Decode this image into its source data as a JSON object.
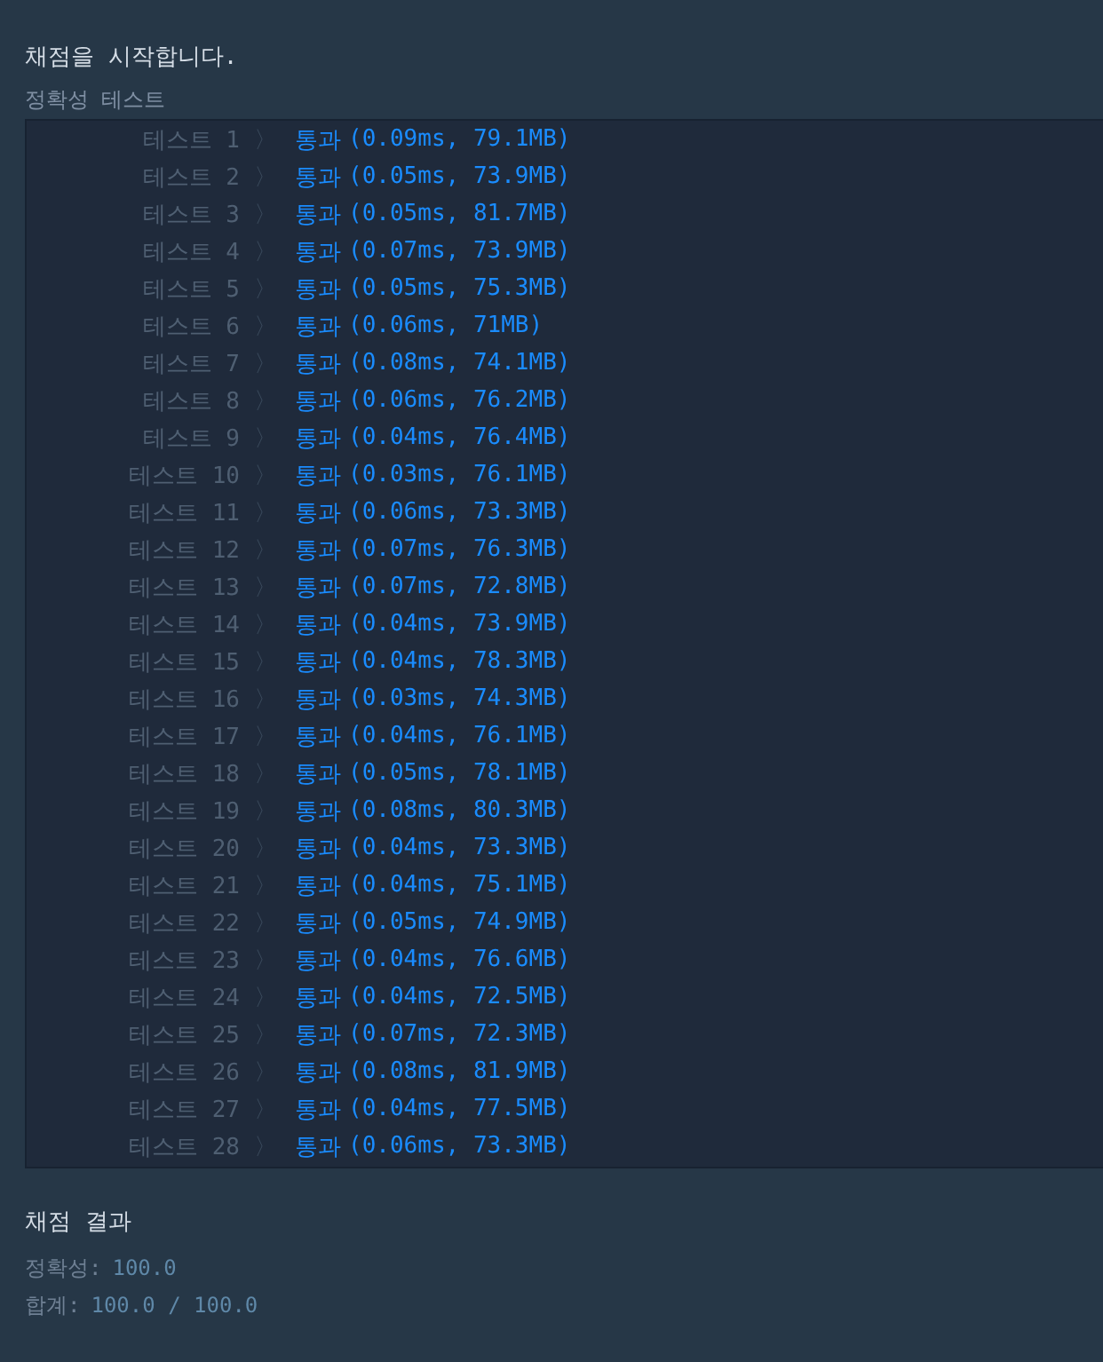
{
  "header": "채점을 시작합니다.",
  "section": "정확성  테스트",
  "tests": [
    {
      "label": "테스트 1",
      "separator": "〉",
      "kind": "pass",
      "result": "통과",
      "detail": "(0.09ms, 79.1MB)"
    },
    {
      "label": "테스트 2",
      "separator": "〉",
      "kind": "pass",
      "result": "통과",
      "detail": "(0.05ms, 73.9MB)"
    },
    {
      "label": "테스트 3",
      "separator": "〉",
      "kind": "pass",
      "result": "통과",
      "detail": "(0.05ms, 81.7MB)"
    },
    {
      "label": "테스트 4",
      "separator": "〉",
      "kind": "pass",
      "result": "통과",
      "detail": "(0.07ms, 73.9MB)"
    },
    {
      "label": "테스트 5",
      "separator": "〉",
      "kind": "pass",
      "result": "통과",
      "detail": "(0.05ms, 75.3MB)"
    },
    {
      "label": "테스트 6",
      "separator": "〉",
      "kind": "pass",
      "result": "통과",
      "detail": "(0.06ms, 71MB)"
    },
    {
      "label": "테스트 7",
      "separator": "〉",
      "kind": "pass",
      "result": "통과",
      "detail": "(0.08ms, 74.1MB)"
    },
    {
      "label": "테스트 8",
      "separator": "〉",
      "kind": "pass",
      "result": "통과",
      "detail": "(0.06ms, 76.2MB)"
    },
    {
      "label": "테스트 9",
      "separator": "〉",
      "kind": "pass",
      "result": "통과",
      "detail": "(0.04ms, 76.4MB)"
    },
    {
      "label": "테스트 10",
      "separator": "〉",
      "kind": "pass",
      "result": "통과",
      "detail": "(0.03ms, 76.1MB)"
    },
    {
      "label": "테스트 11",
      "separator": "〉",
      "kind": "pass",
      "result": "통과",
      "detail": "(0.06ms, 73.3MB)"
    },
    {
      "label": "테스트 12",
      "separator": "〉",
      "kind": "pass",
      "result": "통과",
      "detail": "(0.07ms, 76.3MB)"
    },
    {
      "label": "테스트 13",
      "separator": "〉",
      "kind": "pass",
      "result": "통과",
      "detail": "(0.07ms, 72.8MB)"
    },
    {
      "label": "테스트 14",
      "separator": "〉",
      "kind": "pass",
      "result": "통과",
      "detail": "(0.04ms, 73.9MB)"
    },
    {
      "label": "테스트 15",
      "separator": "〉",
      "kind": "pass",
      "result": "통과",
      "detail": "(0.04ms, 78.3MB)"
    },
    {
      "label": "테스트 16",
      "separator": "〉",
      "kind": "pass",
      "result": "통과",
      "detail": "(0.03ms, 74.3MB)"
    },
    {
      "label": "테스트 17",
      "separator": "〉",
      "kind": "pass",
      "result": "통과",
      "detail": "(0.04ms, 76.1MB)"
    },
    {
      "label": "테스트 18",
      "separator": "〉",
      "kind": "pass",
      "result": "통과",
      "detail": "(0.05ms, 78.1MB)"
    },
    {
      "label": "테스트 19",
      "separator": "〉",
      "kind": "pass",
      "result": "통과",
      "detail": "(0.08ms, 80.3MB)"
    },
    {
      "label": "테스트 20",
      "separator": "〉",
      "kind": "pass",
      "result": "통과",
      "detail": "(0.04ms, 73.3MB)"
    },
    {
      "label": "테스트 21",
      "separator": "〉",
      "kind": "pass",
      "result": "통과",
      "detail": "(0.04ms, 75.1MB)"
    },
    {
      "label": "테스트 22",
      "separator": "〉",
      "kind": "pass",
      "result": "통과",
      "detail": "(0.05ms, 74.9MB)"
    },
    {
      "label": "테스트 23",
      "separator": "〉",
      "kind": "pass",
      "result": "통과",
      "detail": "(0.04ms, 76.6MB)"
    },
    {
      "label": "테스트 24",
      "separator": "〉",
      "kind": "pass",
      "result": "통과",
      "detail": "(0.04ms, 72.5MB)"
    },
    {
      "label": "테스트 25",
      "separator": "〉",
      "kind": "pass",
      "result": "통과",
      "detail": "(0.07ms, 72.3MB)"
    },
    {
      "label": "테스트 26",
      "separator": "〉",
      "kind": "pass",
      "result": "통과",
      "detail": "(0.08ms, 81.9MB)"
    },
    {
      "label": "테스트 27",
      "separator": "〉",
      "kind": "pass",
      "result": "통과",
      "detail": "(0.04ms, 77.5MB)"
    },
    {
      "label": "테스트 28",
      "separator": "〉",
      "kind": "pass",
      "result": "통과",
      "detail": "(0.06ms, 73.3MB)"
    }
  ],
  "summary": {
    "title": "채점 결과",
    "lines": [
      {
        "label": "정확성:",
        "value": "100.0"
      },
      {
        "label": "합계:",
        "value": "100.0 / 100.0"
      }
    ]
  }
}
